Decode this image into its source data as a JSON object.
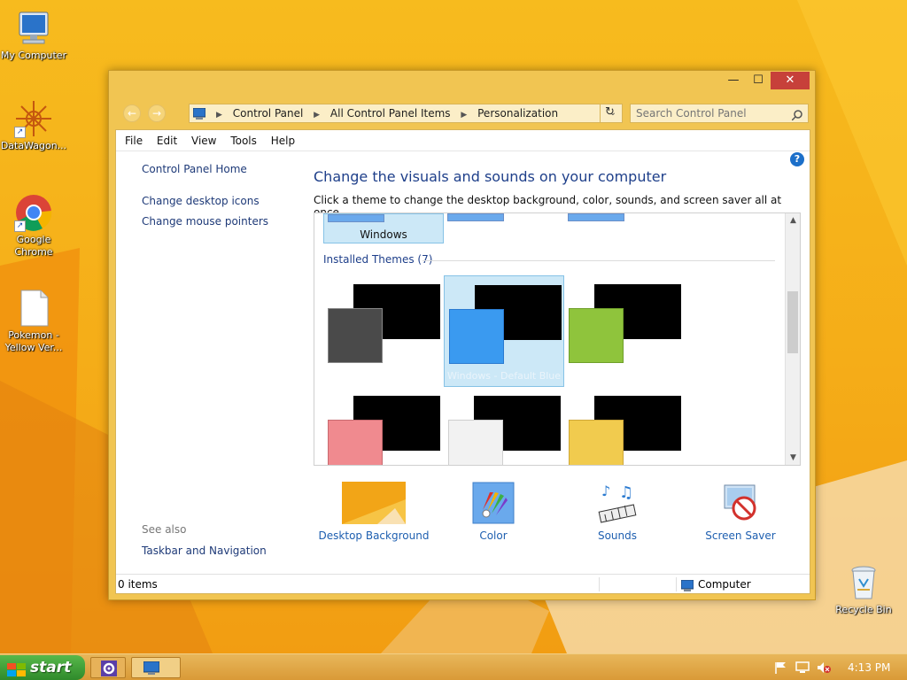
{
  "desktop": {
    "icons": [
      {
        "label": "My Computer"
      },
      {
        "label": "DataWagon..."
      },
      {
        "label": "Google Chrome"
      },
      {
        "label": "Pokemon - Yellow Ver..."
      },
      {
        "label": "Recycle Bin"
      }
    ]
  },
  "window": {
    "caption": {
      "minimize": "—",
      "maximize": "☐",
      "close": "✕"
    },
    "nav": {
      "back": "←",
      "forward": "→"
    },
    "address": {
      "crumbs": [
        "Control Panel",
        "All Control Panel Items",
        "Personalization"
      ],
      "dropdown": "⌄",
      "refresh": "↻"
    },
    "search": {
      "placeholder": "Search Control Panel"
    },
    "menu": [
      "File",
      "Edit",
      "View",
      "Tools",
      "Help"
    ],
    "left_pane": {
      "home": "Control Panel Home",
      "links": [
        "Change desktop icons",
        "Change mouse pointers"
      ],
      "see_also": "See also",
      "see_also_links": [
        "Taskbar and Navigation"
      ]
    },
    "main": {
      "title": "Change the visuals and sounds on your computer",
      "subtitle": "Click a theme to change the desktop background, color, sounds, and screen saver all at once.",
      "help": "?"
    },
    "themes": {
      "windows_label": "Windows",
      "section": "Installed Themes (7)",
      "selected_name": "Windows - Default Blue",
      "tiles": [
        {
          "color": "#4a4a4a"
        },
        {
          "color": "#3a9af0"
        },
        {
          "color": "#8fc43c"
        },
        {
          "color": "#f08a8f"
        },
        {
          "color": "#f2f2f2"
        },
        {
          "color": "#f1cb4e"
        }
      ]
    },
    "options": [
      {
        "label": "Desktop Background"
      },
      {
        "label": "Color"
      },
      {
        "label": "Sounds"
      },
      {
        "label": "Screen Saver"
      }
    ],
    "status": {
      "items": "0 items",
      "location": "Computer"
    }
  },
  "taskbar": {
    "start": "start",
    "clock": "4:13 PM"
  },
  "colors": {
    "accent_orange": "#f6b21b",
    "window_frame": "#f1c552",
    "link_blue": "#1e3f8a",
    "close_red": "#c7403a",
    "start_green": "#3f9a38"
  }
}
